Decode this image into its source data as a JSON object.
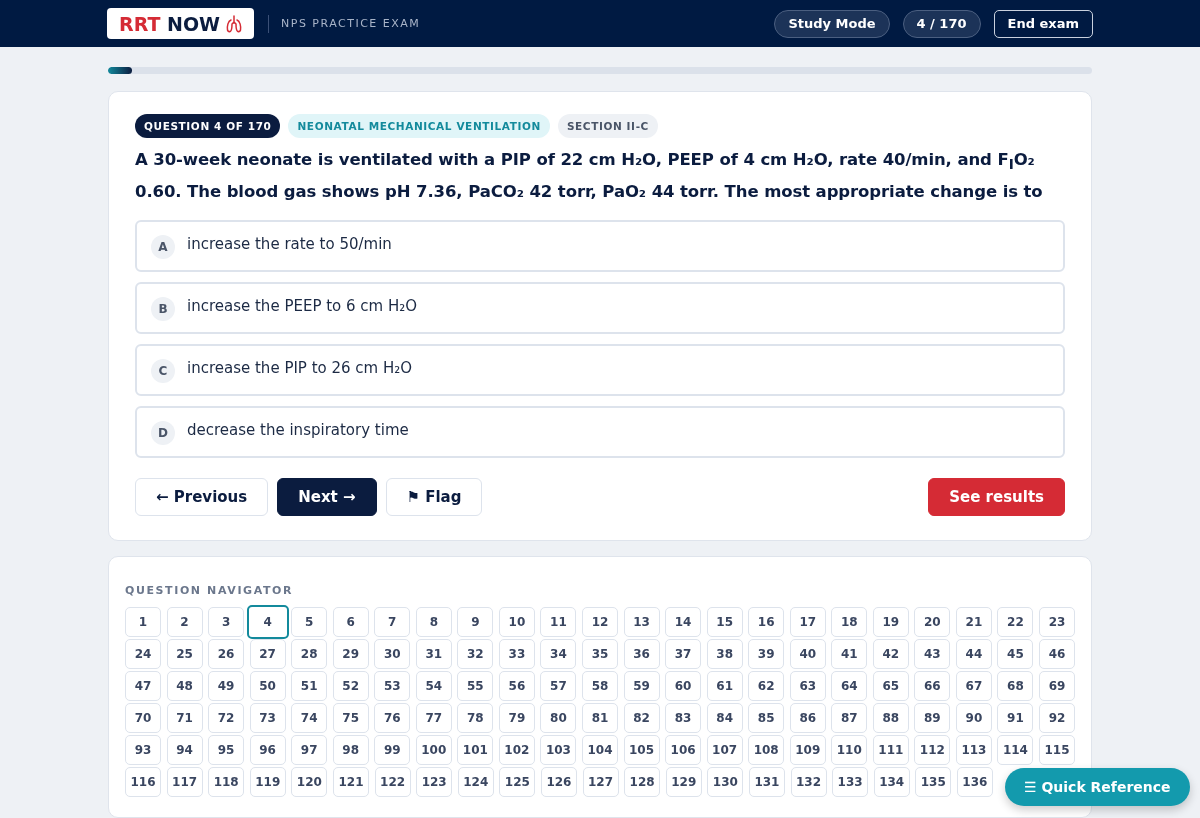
{
  "header": {
    "logo_text": "RRT NOW",
    "exam_label": "NPS PRACTICE EXAM",
    "buttons": [
      {
        "label": "Study Mode",
        "kind": "pill"
      },
      {
        "label": "4 / 170",
        "kind": "pill"
      },
      {
        "label": "End exam",
        "kind": "outline"
      }
    ]
  },
  "progress": {
    "level": 0.024
  },
  "question": {
    "badges": [
      {
        "label": "QUESTION 4 OF 170",
        "kind": "dark"
      },
      {
        "label": "NEONATAL MECHANICAL VENTILATION",
        "kind": "topic"
      },
      {
        "label": "SECTION II-C",
        "kind": "muted"
      }
    ],
    "text": "A 30-week neonate is ventilated with a PIP of 22 cm H₂O, PEEP of 4 cm H₂O, rate 40/min, and F$_{I}$O₂ 0.60. The blood gas shows pH 7.36, PaCO₂ 42 torr, PaO₂ 44 torr. The most appropriate change is to",
    "options": [
      {
        "letter": "A",
        "text": "increase the rate to 50/min",
        "selected": false
      },
      {
        "letter": "B",
        "text": "increase the PEEP to 6 cm H₂O",
        "selected": false
      },
      {
        "letter": "C",
        "text": "increase the PIP to 26 cm H₂O",
        "selected": false
      },
      {
        "letter": "D",
        "text": "decrease the inspiratory time",
        "selected": false
      }
    ],
    "actions": [
      {
        "label": "← Previous",
        "kind": "secondary"
      },
      {
        "label": "Next →",
        "kind": "primary"
      },
      {
        "label": "⚑ Flag",
        "kind": "secondary"
      },
      {
        "label": "See results",
        "kind": "danger"
      }
    ]
  },
  "navigator": {
    "title": "QUESTION NAVIGATOR",
    "rows": [
      [
        {
          "label": "1",
          "selected": false
        },
        {
          "label": "2",
          "selected": false
        },
        {
          "label": "3",
          "selected": false
        },
        {
          "label": "4",
          "selected": true
        },
        {
          "label": "5",
          "selected": false
        },
        {
          "label": "6",
          "selected": false
        },
        {
          "label": "7",
          "selected": false
        },
        {
          "label": "8",
          "selected": false
        },
        {
          "label": "9",
          "selected": false
        },
        {
          "label": "10",
          "selected": false
        },
        {
          "label": "11",
          "selected": false
        },
        {
          "label": "12",
          "selected": false
        },
        {
          "label": "13",
          "selected": false
        },
        {
          "label": "14",
          "selected": false
        },
        {
          "label": "15",
          "selected": false
        },
        {
          "label": "16",
          "selected": false
        },
        {
          "label": "17",
          "selected": false
        },
        {
          "label": "18",
          "selected": false
        },
        {
          "label": "19",
          "selected": false
        },
        {
          "label": "20",
          "selected": false
        },
        {
          "label": "21",
          "selected": false
        },
        {
          "label": "22",
          "selected": false
        },
        {
          "label": "23",
          "selected": false
        }
      ],
      [
        {
          "label": "24",
          "selected": false
        },
        {
          "label": "25",
          "selected": false
        },
        {
          "label": "26",
          "selected": false
        },
        {
          "label": "27",
          "selected": false
        },
        {
          "label": "28",
          "selected": false
        },
        {
          "label": "29",
          "selected": false
        },
        {
          "label": "30",
          "selected": false
        },
        {
          "label": "31",
          "selected": false
        },
        {
          "label": "32",
          "selected": false
        },
        {
          "label": "33",
          "selected": false
        },
        {
          "label": "34",
          "selected": false
        },
        {
          "label": "35",
          "selected": false
        },
        {
          "label": "36",
          "selected": false
        },
        {
          "label": "37",
          "selected": false
        },
        {
          "label": "38",
          "selected": false
        },
        {
          "label": "39",
          "selected": false
        },
        {
          "label": "40",
          "selected": false
        },
        {
          "label": "41",
          "selected": false
        },
        {
          "label": "42",
          "selected": false
        },
        {
          "label": "43",
          "selected": false
        },
        {
          "label": "44",
          "selected": false
        },
        {
          "label": "45",
          "selected": false
        },
        {
          "label": "46",
          "selected": false
        }
      ],
      [
        {
          "label": "47",
          "selected": false
        },
        {
          "label": "48",
          "selected": false
        },
        {
          "label": "49",
          "selected": false
        },
        {
          "label": "50",
          "selected": false
        },
        {
          "label": "51",
          "selected": false
        },
        {
          "label": "52",
          "selected": false
        },
        {
          "label": "53",
          "selected": false
        },
        {
          "label": "54",
          "selected": false
        },
        {
          "label": "55",
          "selected": false
        },
        {
          "label": "56",
          "selected": false
        },
        {
          "label": "57",
          "selected": false
        },
        {
          "label": "58",
          "selected": false
        },
        {
          "label": "59",
          "selected": false
        },
        {
          "label": "60",
          "selected": false
        },
        {
          "label": "61",
          "selected": false
        },
        {
          "label": "62",
          "selected": false
        },
        {
          "label": "63",
          "selected": false
        },
        {
          "label": "64",
          "selected": false
        },
        {
          "label": "65",
          "selected": false
        },
        {
          "label": "66",
          "selected": false
        },
        {
          "label": "67",
          "selected": false
        },
        {
          "label": "68",
          "selected": false
        },
        {
          "label": "69",
          "selected": false
        }
      ],
      [
        {
          "label": "70",
          "selected": false
        },
        {
          "label": "71",
          "selected": false
        },
        {
          "label": "72",
          "selected": false
        },
        {
          "label": "73",
          "selected": false
        },
        {
          "label": "74",
          "selected": false
        },
        {
          "label": "75",
          "selected": false
        },
        {
          "label": "76",
          "selected": false
        },
        {
          "label": "77",
          "selected": false
        },
        {
          "label": "78",
          "selected": false
        },
        {
          "label": "79",
          "selected": false
        },
        {
          "label": "80",
          "selected": false
        },
        {
          "label": "81",
          "selected": false
        },
        {
          "label": "82",
          "selected": false
        },
        {
          "label": "83",
          "selected": false
        },
        {
          "label": "84",
          "selected": false
        },
        {
          "label": "85",
          "selected": false
        },
        {
          "label": "86",
          "selected": false
        },
        {
          "label": "87",
          "selected": false
        },
        {
          "label": "88",
          "selected": false
        },
        {
          "label": "89",
          "selected": false
        },
        {
          "label": "90",
          "selected": false
        },
        {
          "label": "91",
          "selected": false
        },
        {
          "label": "92",
          "selected": false
        }
      ],
      [
        {
          "label": "93",
          "selected": false
        },
        {
          "label": "94",
          "selected": false
        },
        {
          "label": "95",
          "selected": false
        },
        {
          "label": "96",
          "selected": false
        },
        {
          "label": "97",
          "selected": false
        },
        {
          "label": "98",
          "selected": false
        },
        {
          "label": "99",
          "selected": false
        },
        {
          "label": "100",
          "selected": false
        },
        {
          "label": "101",
          "selected": false
        },
        {
          "label": "102",
          "selected": false
        },
        {
          "label": "103",
          "selected": false
        },
        {
          "label": "104",
          "selected": false
        },
        {
          "label": "105",
          "selected": false
        },
        {
          "label": "106",
          "selected": false
        },
        {
          "label": "107",
          "selected": false
        },
        {
          "label": "108",
          "selected": false
        },
        {
          "label": "109",
          "selected": false
        },
        {
          "label": "110",
          "selected": false
        },
        {
          "label": "111",
          "selected": false
        },
        {
          "label": "112",
          "selected": false
        },
        {
          "label": "113",
          "selected": false
        },
        {
          "label": "114",
          "selected": false
        },
        {
          "label": "115",
          "selected": false
        }
      ],
      [
        {
          "label": "116",
          "selected": false
        },
        {
          "label": "117",
          "selected": false
        },
        {
          "label": "118",
          "selected": false
        },
        {
          "label": "119",
          "selected": false
        },
        {
          "label": "120",
          "selected": false
        },
        {
          "label": "121",
          "selected": false
        },
        {
          "label": "122",
          "selected": false
        },
        {
          "label": "123",
          "selected": false
        },
        {
          "label": "124",
          "selected": false
        },
        {
          "label": "125",
          "selected": false
        },
        {
          "label": "126",
          "selected": false
        },
        {
          "label": "127",
          "selected": false
        },
        {
          "label": "128",
          "selected": false
        },
        {
          "label": "129",
          "selected": false
        },
        {
          "label": "130",
          "selected": false
        },
        {
          "label": "131",
          "selected": false
        },
        {
          "label": "132",
          "selected": false
        },
        {
          "label": "133",
          "selected": false
        },
        {
          "label": "134",
          "selected": false
        },
        {
          "label": "135",
          "selected": false
        },
        {
          "label": "136",
          "selected": false
        }
      ]
    ]
  },
  "quick_reference": {
    "label": "☰ Quick Reference"
  }
}
